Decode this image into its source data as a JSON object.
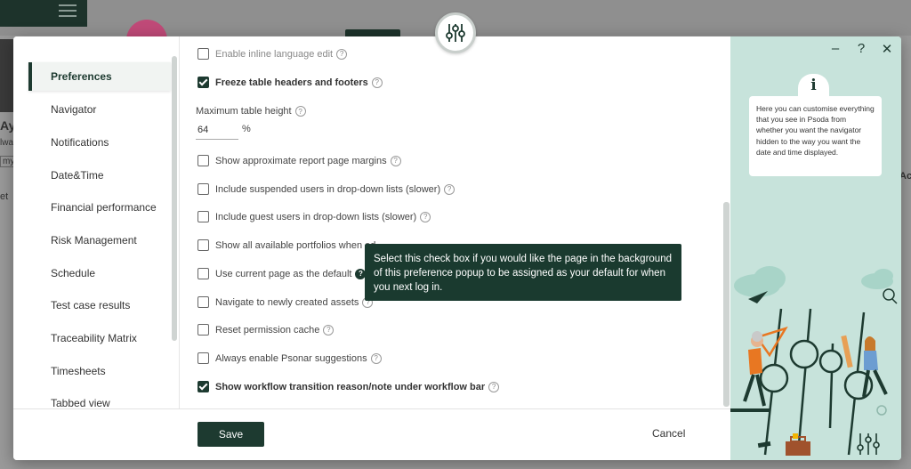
{
  "background": {
    "name_fragment": "Ay",
    "sub_fragment": "lwa",
    "pill_fragment": "my",
    "side_fragment": "et",
    "right_fragment": "Ac"
  },
  "nav": {
    "items": [
      {
        "label": "Preferences",
        "active": true
      },
      {
        "label": "Navigator"
      },
      {
        "label": "Notifications"
      },
      {
        "label": "Date&Time"
      },
      {
        "label": "Financial performance"
      },
      {
        "label": "Risk Management"
      },
      {
        "label": "Schedule"
      },
      {
        "label": "Test case results"
      },
      {
        "label": "Traceability Matrix"
      },
      {
        "label": "Timesheets"
      },
      {
        "label": "Tabbed view"
      }
    ]
  },
  "prefs": {
    "inline_edit": {
      "label": "Enable inline language edit",
      "checked": false
    },
    "freeze_headers": {
      "label": "Freeze table headers and footers",
      "checked": true
    },
    "max_height": {
      "label": "Maximum table height",
      "value": "64",
      "unit": "%"
    },
    "report_margins": {
      "label": "Show approximate report page margins",
      "checked": false
    },
    "suspended_users": {
      "label": "Include suspended users in drop-down lists (slower)",
      "checked": false
    },
    "guest_users": {
      "label": "Include guest users in drop-down lists (slower)",
      "checked": false
    },
    "all_portfolios": {
      "label": "Show all available portfolios when ed",
      "checked": false
    },
    "current_page_default": {
      "label": "Use current page as the default",
      "checked": false
    },
    "navigate_new_assets": {
      "label": "Navigate to newly created assets",
      "checked": false
    },
    "reset_permission": {
      "label": "Reset permission cache",
      "checked": false
    },
    "psonar": {
      "label": "Always enable Psonar suggestions",
      "checked": false
    },
    "workflow_reason": {
      "label": "Show workflow transition reason/note under workflow bar",
      "checked": true
    }
  },
  "tooltip": {
    "text": "Select this check box if you would like the page in the background of this preference popup to be assigned as your default for when you next log in."
  },
  "footer": {
    "save_label": "Save",
    "cancel_label": "Cancel"
  },
  "side": {
    "minimize": "–",
    "help": "?",
    "close": "✕",
    "info_icon": "i",
    "info_text": "Here you can customise everything that you see in Psoda from whether you want the navigator hidden to the way you want the date and time displayed."
  },
  "icons": {
    "top": "sliders-icon"
  },
  "colors": {
    "primary": "#1d3a30",
    "side_bg": "#c7e3db",
    "accent_orange": "#e87722"
  }
}
